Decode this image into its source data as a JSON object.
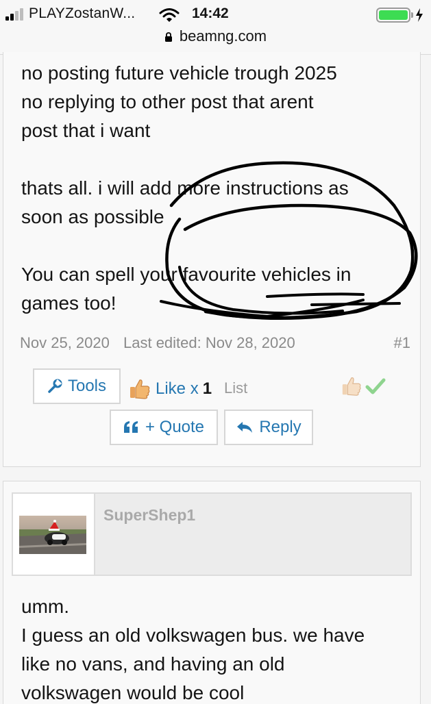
{
  "status_bar": {
    "carrier": "PLAYZostanW...",
    "time": "14:42",
    "url": "beamng.com"
  },
  "post1": {
    "lines": [
      "no posting future vehicle trough 2025",
      "no replying to other post that arent",
      "post that i want",
      "thats all. i will add more instructions as",
      "soon as possible",
      "You can spell your favourite vehicles in",
      "games too!"
    ],
    "date": "Nov 25, 2020",
    "last_edited": "Last edited: Nov 28, 2020",
    "post_number": "#1",
    "tools_label": "Tools",
    "like_label": "Like x",
    "like_count": "1",
    "list_label": "List",
    "quote_label": "+ Quote",
    "reply_label": "Reply"
  },
  "post2": {
    "username": "SuperShep1",
    "lines": [
      "umm.",
      "I guess an old volkswagen bus. we have",
      "like no vans, and having an old",
      "volkswagen would be cool"
    ]
  },
  "colors": {
    "link": "#2577b1",
    "battery": "#3ddc53",
    "check": "#8fd48f"
  },
  "icons": [
    "signal-icon",
    "wifi-icon",
    "battery-icon",
    "charging-icon",
    "lock-icon",
    "wrench-icon",
    "thumbs-up-icon",
    "check-icon",
    "quote-icon",
    "reply-arrow-icon"
  ]
}
